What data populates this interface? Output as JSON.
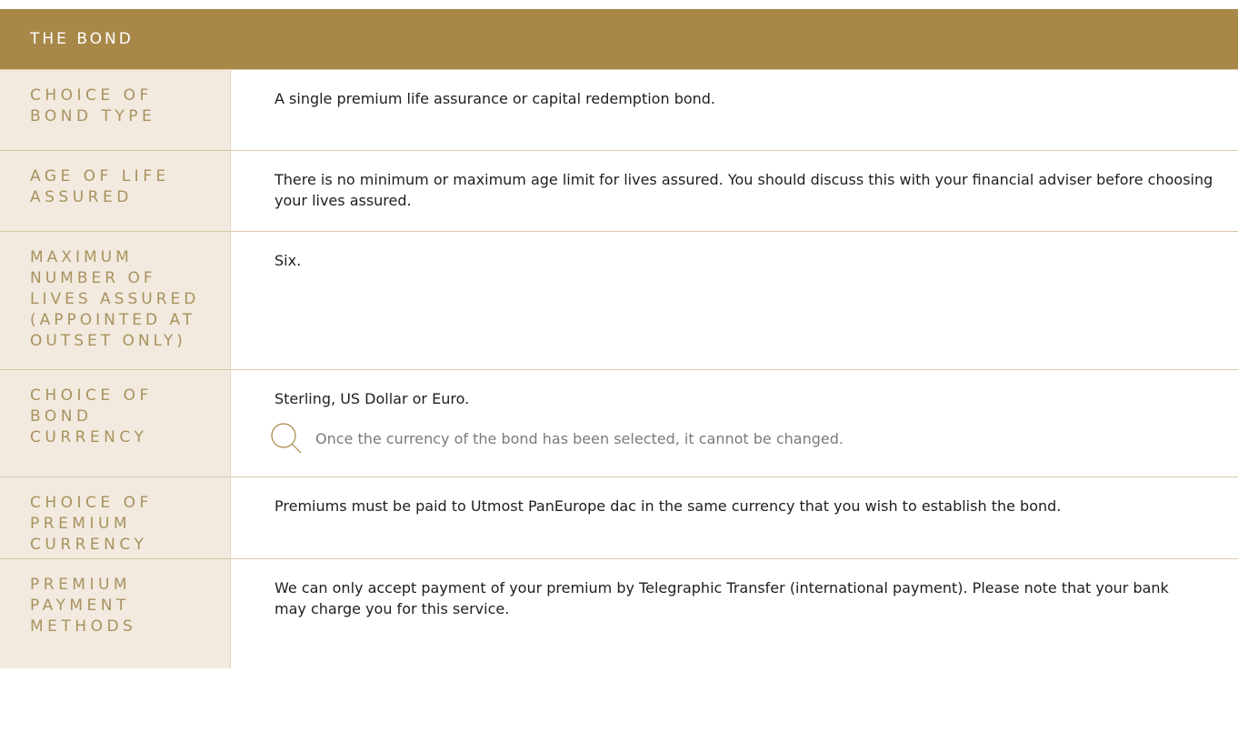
{
  "header": {
    "title": "THE BOND"
  },
  "rows": [
    {
      "label": "CHOICE OF BOND TYPE",
      "text": "A single premium life assurance or capital redemption bond."
    },
    {
      "label": "AGE OF LIFE ASSURED",
      "text": "There is no minimum or maximum age limit for lives assured. You should discuss this with your financial adviser before choosing your lives assured."
    },
    {
      "label": "MAXIMUM NUMBER OF LIVES ASSURED (APPOINTED AT OUTSET ONLY)",
      "text": "Six."
    },
    {
      "label": "CHOICE OF BOND CURRENCY",
      "text": "Sterling, US Dollar or Euro.",
      "note": "Once the currency of the bond has been selected, it cannot be changed.",
      "note_icon": "magnifier-icon"
    },
    {
      "label": "CHOICE OF PREMIUM CURRENCY",
      "text": "Premiums must be paid to Utmost PanEurope dac in the same currency that you wish to establish the bond."
    },
    {
      "label": "PREMIUM PAYMENT METHODS",
      "text": "We can only accept payment of your premium by Telegraphic Transfer (international payment). Please note that your bank may charge you for this service."
    }
  ],
  "colors": {
    "header_bg": "#a88849",
    "label_bg": "#f2eadf",
    "label_text": "#a8925f",
    "body_text": "#1e1e1e",
    "note_text": "#7a7a7a"
  }
}
